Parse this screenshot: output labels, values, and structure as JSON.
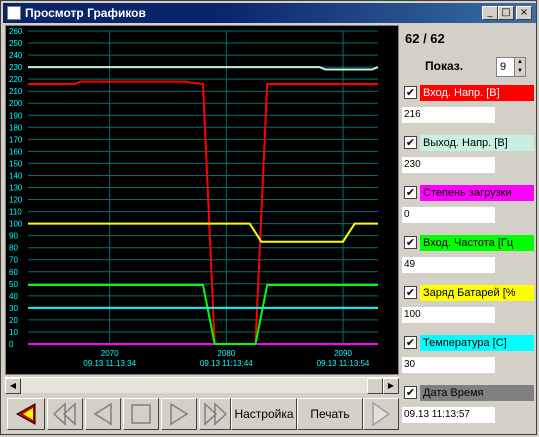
{
  "window": {
    "title": "Просмотр Графиков",
    "buttons": [
      "_",
      "□",
      "×"
    ]
  },
  "panel": {
    "count": "62 / 62",
    "show_label": "Показ.",
    "show_value": "9",
    "params": [
      {
        "label": "Вход. Напр. [В]",
        "value": "216",
        "color": "#ff0000",
        "text_color": "#ffffff",
        "checked": true
      },
      {
        "label": "Выход. Напр. [В]",
        "value": "230",
        "color": "#c8f0e0",
        "text_color": "#000000",
        "checked": true
      },
      {
        "label": "Степень загрузки",
        "value": "0",
        "color": "#ff00ff",
        "text_color": "#000000",
        "checked": true
      },
      {
        "label": "Вход. Частота [Гц",
        "value": "49",
        "color": "#00ff00",
        "text_color": "#000000",
        "checked": true
      },
      {
        "label": "Заряд Батарей [%",
        "value": "100",
        "color": "#ffff00",
        "text_color": "#000000",
        "checked": true
      },
      {
        "label": "Температура [C]",
        "value": "30",
        "color": "#00ffff",
        "text_color": "#000000",
        "checked": true
      },
      {
        "label": "Дата Время",
        "value": "09.13 11:13:57",
        "color": "#808080",
        "text_color": "#000000",
        "checked": true
      }
    ]
  },
  "toolbar": {
    "settings_label": "Настройка",
    "print_label": "Печать"
  },
  "chart_data": {
    "type": "line",
    "x": [
      2063,
      2093
    ],
    "ylim": [
      0,
      260
    ],
    "yticks": [
      0,
      10,
      20,
      30,
      40,
      50,
      60,
      70,
      80,
      90,
      100,
      110,
      120,
      130,
      140,
      150,
      160,
      170,
      180,
      190,
      200,
      210,
      220,
      230,
      240,
      250,
      260
    ],
    "xticks": [
      {
        "value": 2070,
        "label": "2070",
        "sublabel": "09.13 11:13:34"
      },
      {
        "value": 2080,
        "label": "2080",
        "sublabel": "09.13 11:13:44"
      },
      {
        "value": 2090,
        "label": "2090",
        "sublabel": "09.13 11:13:54"
      }
    ],
    "series": [
      {
        "name": "Вход. Напр. [В]",
        "color": "#ff0000",
        "points": [
          [
            2063,
            216
          ],
          [
            2067,
            216
          ],
          [
            2067.5,
            218
          ],
          [
            2076.5,
            218
          ],
          [
            2077,
            217
          ],
          [
            2078,
            216
          ],
          [
            2079,
            0
          ],
          [
            2082.5,
            0
          ],
          [
            2083.5,
            216
          ],
          [
            2093,
            216
          ]
        ]
      },
      {
        "name": "Выход. Напр. [В]",
        "color": "#c8f0e0",
        "points": [
          [
            2063,
            230
          ],
          [
            2088,
            230
          ],
          [
            2088.5,
            228
          ],
          [
            2092.5,
            228
          ],
          [
            2093,
            230
          ]
        ]
      },
      {
        "name": "Степень загрузки",
        "color": "#ff00ff",
        "points": [
          [
            2063,
            0
          ],
          [
            2093,
            0
          ]
        ]
      },
      {
        "name": "Вход. Частота [Гц",
        "color": "#00ff00",
        "points": [
          [
            2063,
            49
          ],
          [
            2078,
            49
          ],
          [
            2079,
            0
          ],
          [
            2082.5,
            0
          ],
          [
            2083.5,
            49
          ],
          [
            2093,
            49
          ]
        ]
      },
      {
        "name": "Заряд Батарей [%",
        "color": "#ffff00",
        "points": [
          [
            2063,
            100
          ],
          [
            2082,
            100
          ],
          [
            2083,
            85
          ],
          [
            2090,
            85
          ],
          [
            2091,
            100
          ],
          [
            2093,
            100
          ]
        ]
      },
      {
        "name": "Температура [C]",
        "color": "#00ffff",
        "points": [
          [
            2063,
            30
          ],
          [
            2093,
            30
          ]
        ]
      }
    ]
  }
}
